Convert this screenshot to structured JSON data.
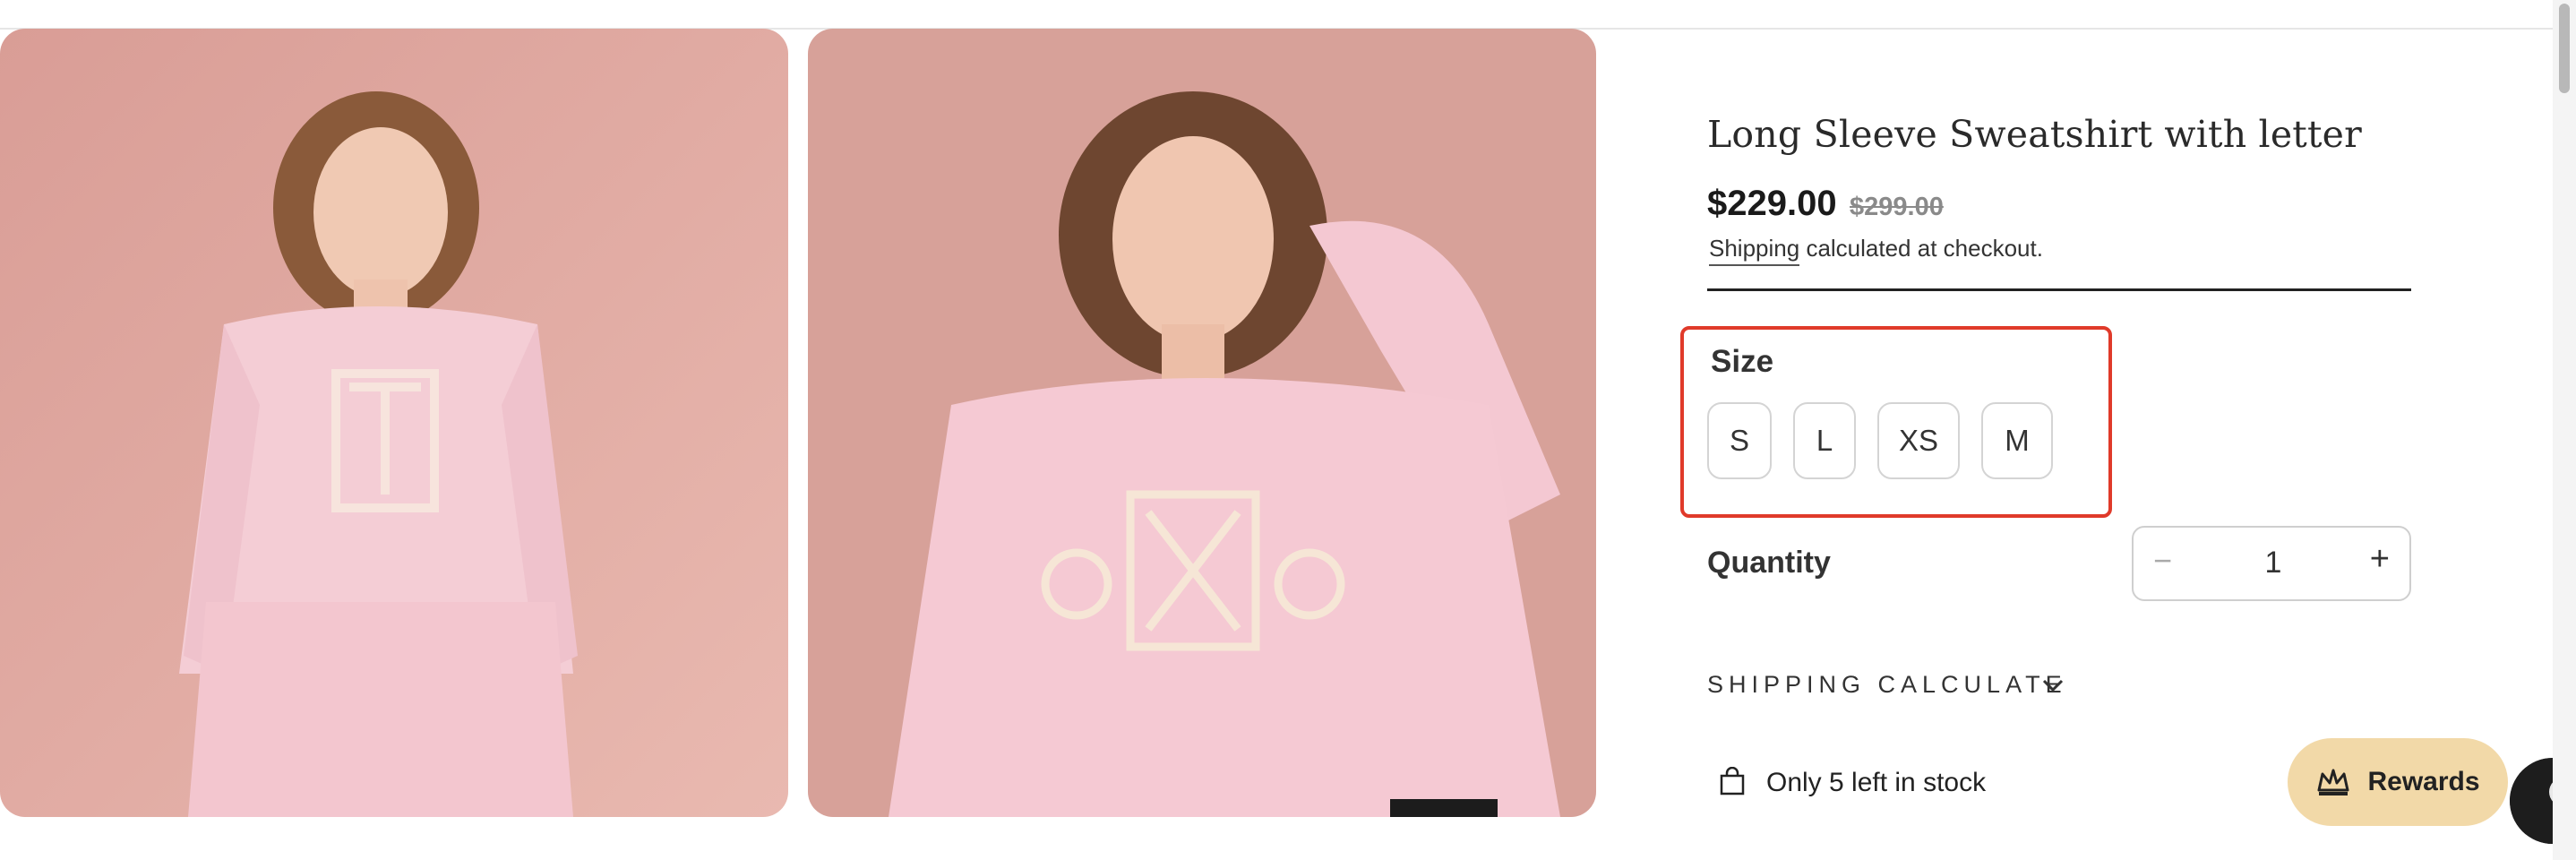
{
  "product": {
    "title": "Long Sleeve Sweatshirt with letter",
    "price": "$229.00",
    "compare_price": "$299.00",
    "shipping_link": "Shipping",
    "shipping_note": "calculated at checkout."
  },
  "size": {
    "label": "Size",
    "options": [
      "S",
      "L",
      "XS",
      "M"
    ]
  },
  "quantity": {
    "label": "Quantity",
    "value": "1",
    "minus": "−",
    "plus": "+"
  },
  "shipping_calculate": {
    "label": "SHIPPING CALCULATE",
    "icon": "chevron-down-icon"
  },
  "stock": {
    "text": "Only 5 left in stock",
    "icon": "shopping-bag-icon"
  },
  "rewards": {
    "label": "Rewards",
    "icon": "crown-icon"
  },
  "colors": {
    "highlight": "#e03a2a",
    "rewards_bg": "#f2d9a8",
    "photo_bg": "#d9a39c",
    "sweatshirt": "#f5c9d3"
  }
}
